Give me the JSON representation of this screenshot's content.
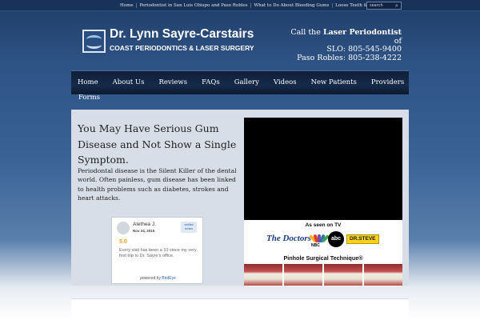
{
  "top_nav": {
    "links": [
      "Home",
      "Periodontist in San Luis Obispo and Paso Robles",
      "What to Do About Bleeding Gums",
      "Loose Teeth & Sore Gums"
    ],
    "search_placeholder": "search"
  },
  "header": {
    "title": "Dr. Lynn Sayre-Carstairs",
    "subtitle": "COAST PERIODONTICS & LASER SURGERY",
    "contact_prefix": "Call the",
    "contact_strong": "Laser Periodontist",
    "contact_of": "of",
    "phone_slo": "SLO: 805-545-9400",
    "phone_paso": "Paso Robles: 805-238-4222"
  },
  "main_nav": {
    "items": [
      "Home",
      "About Us",
      "Reviews",
      "FAQs",
      "Gallery",
      "Videos",
      "New Patients",
      "Providers"
    ],
    "forms": "Forms"
  },
  "content": {
    "headline": "You May Have Serious Gum Disease and Not Show a Single Symptom.",
    "body": "Periodontal disease is the Silent Killer of the dental world. Often painless, gum disease has been linked to health problems such as diabetes, strokes and heart attacks."
  },
  "promo": {
    "as_seen": "As seen on TV",
    "logo_doctors": "The Doctors",
    "logo_nbc": "NBC",
    "logo_abc": "abc",
    "logo_drsteve": "DR.STEVE",
    "pinhole": "Pinhole Surgical Technique®"
  },
  "review": {
    "name": "Alethea J.",
    "date": "Nov 24, 2015",
    "badge": "verified review",
    "score": "5.0",
    "text": "Every visit has been a 10 since my very first trip to Dr. Sayre's office.",
    "footer_prefix": "powered by",
    "footer_brand": "BirdEye"
  }
}
